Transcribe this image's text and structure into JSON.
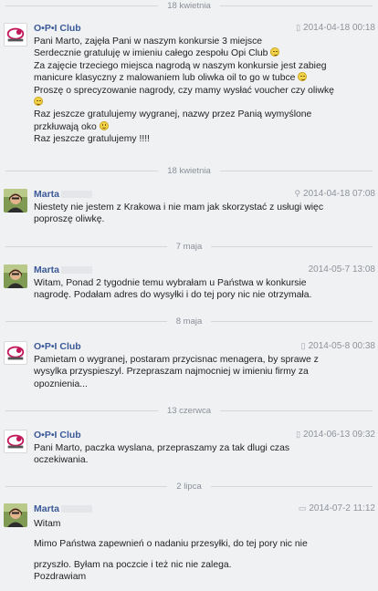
{
  "dividers": [
    "18 kwietnia",
    "18 kwietnia",
    "7 maja",
    "8 maja",
    "13 czerwca",
    "2 lipca"
  ],
  "messages": [
    {
      "sender": "O•P•I Club",
      "time": "2014-04-18 00:18",
      "meta_icon": "mobile-icon",
      "lines": [
        "Pani Marto, zajęła Pani w naszym konkursie 3 miejsce",
        "Serdecznie gratuluję w imieniu całego zespołu Opi Club",
        "Za zajęcie trzeciego miejsca nagrodą w naszym konkursie jest zabieg",
        "manicure klasyczny z malowaniem lub oliwka oil to go w tubce",
        "Proszę o sprecyzowanie nagrody, czy mamy wysłać voucher czy oliwkę",
        "",
        "Raz jeszcze gratulujemy wygranej, nazwy przez Panią wymyślone",
        "przkłuwają oko",
        "Raz jeszcze gratulujemy !!!!"
      ]
    },
    {
      "sender": "Marta",
      "time": "2014-04-18 07:08",
      "meta_icon": "location-pin-icon",
      "lines": [
        "Niestety nie jestem z Krakowa i nie mam jak skorzystać z usługi więc",
        "poproszę oliwkę."
      ]
    },
    {
      "sender": "Marta",
      "time": "2014-05-7 13:08",
      "meta_icon": "",
      "lines": [
        "Witam, Ponad 2 tygodnie temu wybrałam u Państwa w konkursie",
        "nagrodę. Podałam adres do wysyłki i do tej pory nic nie otrzymała."
      ]
    },
    {
      "sender": "O•P•I Club",
      "time": "2014-05-8 00:38",
      "meta_icon": "mobile-icon",
      "lines": [
        "Pamietam o wygranej, postaram przycisnac menagera, by sprawe z",
        "wysylka przyspieszyl. Przepraszam najmocniej w imieniu firmy za",
        "opoznienia..."
      ]
    },
    {
      "sender": "O•P•I Club",
      "time": "2014-06-13 09:32",
      "meta_icon": "mobile-icon",
      "lines": [
        "Pani Marto, paczka wyslana, przepraszamy za tak dlugi czas",
        "oczekiwania."
      ]
    },
    {
      "sender": "Marta",
      "time": "2014-07-2 11:12",
      "meta_icon": "chat-bubble-icon",
      "lines": [
        "Witam",
        "",
        "Mimo Państwa zapewnień o nadaniu przesyłki, do tej pory nic nie",
        "",
        "przyszło. Byłam na poczcie i też nic nie zalega.",
        "Pozdrawiam"
      ]
    }
  ]
}
